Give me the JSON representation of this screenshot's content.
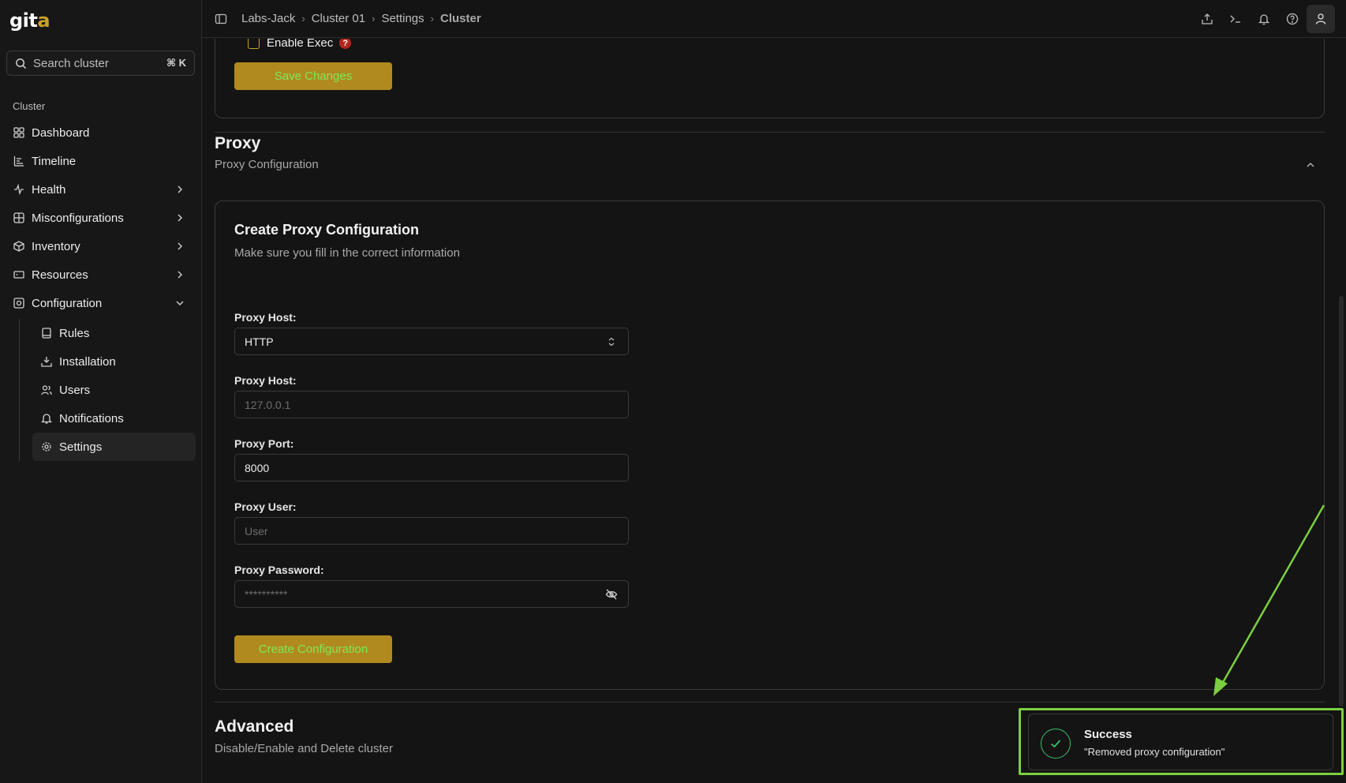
{
  "app": {
    "logo_text": "git",
    "logo_accent": "a"
  },
  "search": {
    "placeholder": "Search cluster",
    "shortcut": "⌘ K"
  },
  "sidebar": {
    "section_label": "Cluster",
    "items": [
      {
        "label": "Dashboard",
        "icon": "grid-icon",
        "expandable": false
      },
      {
        "label": "Timeline",
        "icon": "timeline-icon",
        "expandable": false
      },
      {
        "label": "Health",
        "icon": "activity-icon",
        "expandable": true
      },
      {
        "label": "Misconfigurations",
        "icon": "misconfig-icon",
        "expandable": true
      },
      {
        "label": "Inventory",
        "icon": "box-icon",
        "expandable": true
      },
      {
        "label": "Resources",
        "icon": "resources-icon",
        "expandable": true
      },
      {
        "label": "Configuration",
        "icon": "config-icon",
        "expanded": true
      }
    ],
    "sub_items": [
      {
        "label": "Rules",
        "icon": "book-icon"
      },
      {
        "label": "Installation",
        "icon": "download-icon"
      },
      {
        "label": "Users",
        "icon": "users-icon"
      },
      {
        "label": "Notifications",
        "icon": "bell-icon"
      },
      {
        "label": "Settings",
        "icon": "gear-icon",
        "active": true
      }
    ]
  },
  "breadcrumb": {
    "items": [
      "Labs-Jack",
      "Cluster 01",
      "Settings",
      "Cluster"
    ]
  },
  "general": {
    "enable_exec_label": "Enable Exec",
    "help_glyph": "?",
    "save_label": "Save Changes"
  },
  "proxy": {
    "title": "Proxy",
    "subtitle": "Proxy Configuration",
    "card_title": "Create Proxy Configuration",
    "card_desc": "Make sure you fill in the correct information",
    "protocol_label": "Proxy Host:",
    "protocol_value": "HTTP",
    "host_label": "Proxy Host:",
    "host_placeholder": "127.0.0.1",
    "port_label": "Proxy Port:",
    "port_value": "8000",
    "user_label": "Proxy User:",
    "user_placeholder": "User",
    "password_label": "Proxy Password:",
    "password_placeholder": "**********",
    "create_label": "Create Configuration"
  },
  "advanced": {
    "title": "Advanced",
    "subtitle": "Disable/Enable and Delete cluster"
  },
  "toast": {
    "title": "Success",
    "message": "\"Removed proxy configuration\""
  },
  "colors": {
    "accent": "#b08a1e",
    "button_text": "#7ee85a",
    "highlight": "#7ccf3f",
    "success": "#3fbf6a",
    "help_badge": "#b3261e"
  }
}
